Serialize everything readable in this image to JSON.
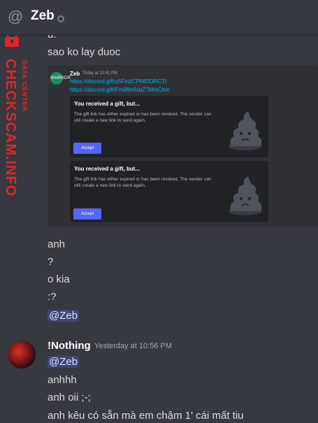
{
  "header": {
    "title": "Zeb",
    "icon": "at-sign-icon"
  },
  "watermark": {
    "big": "CHECKSCAM.INFO",
    "small": "DATA CENTER"
  },
  "messages": {
    "partial": "u.",
    "line1": "sao ko lay duoc",
    "embed": {
      "author": "Zeb",
      "avatar_text": "WARRIOR",
      "time": "Today at 10:41 PM",
      "link1": "https://discord.gift/y5FezjCPMEfDRCTt",
      "link2": "https://discord.gift/Fm8fbr6xbZ7MmChm",
      "gifts": [
        {
          "title": "You received a gift, but...",
          "desc": "The gift link has either expired or has been revoked. The sender can still create a new link to send again.",
          "button": "Accept"
        },
        {
          "title": "You received a gift, but...",
          "desc": "The gift link has either expired or has been revoked. The sender can still create a new link to send again.",
          "button": "Accept"
        }
      ]
    },
    "after": [
      "anh",
      "?",
      "o kia",
      ":?"
    ],
    "mention1": "@Zeb",
    "user2": {
      "name": "!Nothing",
      "time": "Yesterday at 10:56 PM"
    },
    "mention2": "@Zeb",
    "lines2": [
      "anhhh",
      "anh oii ;-;",
      "anh kêu có sẵn mà em chậm 1' cái mất tiu"
    ]
  }
}
